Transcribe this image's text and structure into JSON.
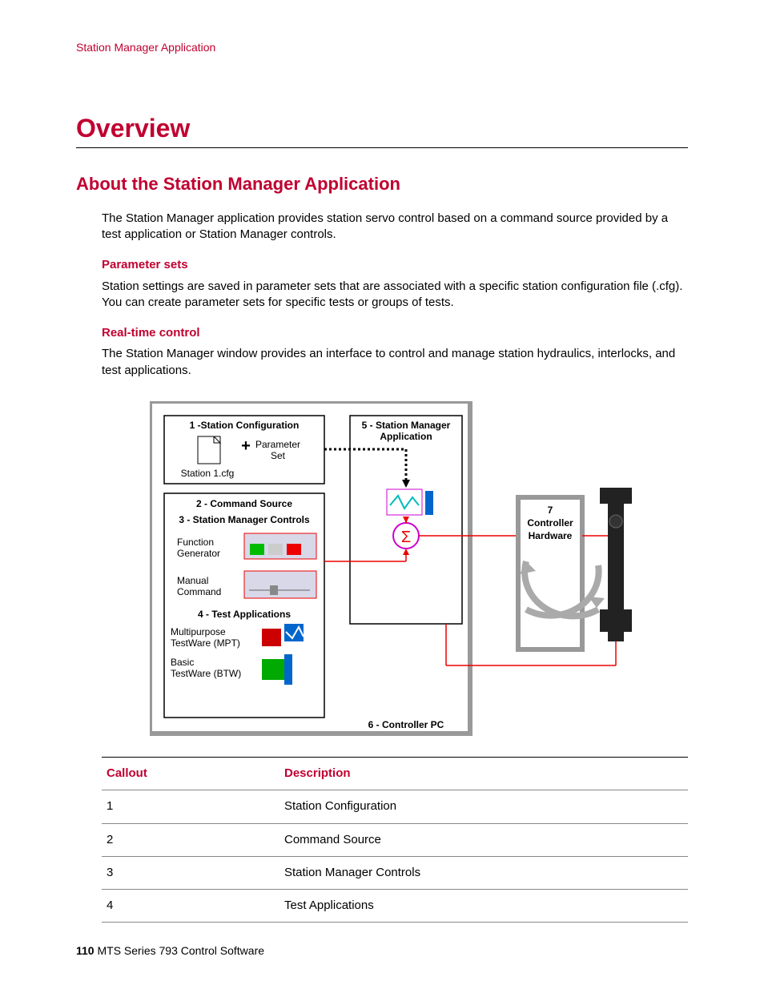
{
  "running_head": "Station Manager Application",
  "h1": "Overview",
  "h2": "About the Station Manager Application",
  "intro": "The Station Manager application provides station servo control based on a command source provided by a test application or Station Manager controls.",
  "sections": {
    "param_sets": {
      "title": "Parameter sets",
      "body": "Station settings are saved in parameter sets that are associated with a specific station configuration file (.cfg). You can create parameter sets for specific tests or groups of tests."
    },
    "rt_control": {
      "title": "Real-time control",
      "body": "The Station Manager window provides an interface to control and manage station hydraulics, interlocks, and test applications."
    }
  },
  "diagram": {
    "callout1": "1 -Station Configuration",
    "param_set": "Parameter",
    "param_set2": "Set",
    "cfg": "Station 1.cfg",
    "callout2": "2 - Command Source",
    "callout3": "3 - Station Manager Controls",
    "func_gen1": "Function",
    "func_gen2": "Generator",
    "manual1": "Manual",
    "manual2": "Command",
    "callout4": "4 - Test Applications",
    "mpt1": "Multipurpose",
    "mpt2": "TestWare (MPT)",
    "btw1": "Basic",
    "btw2": "TestWare (BTW)",
    "callout5a": "5 - Station Manager",
    "callout5b": "Application",
    "callout6": "6 - Controller PC",
    "callout7a": "7",
    "callout7b": "Controller",
    "callout7c": "Hardware",
    "sigma": "Σ"
  },
  "table": {
    "headers": {
      "c1": "Callout",
      "c2": "Description"
    },
    "rows": [
      {
        "c": "1",
        "d": "Station Configuration"
      },
      {
        "c": "2",
        "d": "Command Source"
      },
      {
        "c": "3",
        "d": "Station Manager Controls"
      },
      {
        "c": "4",
        "d": "Test Applications"
      }
    ]
  },
  "footer": {
    "page": "110",
    "title": "MTS Series 793 Control Software"
  }
}
